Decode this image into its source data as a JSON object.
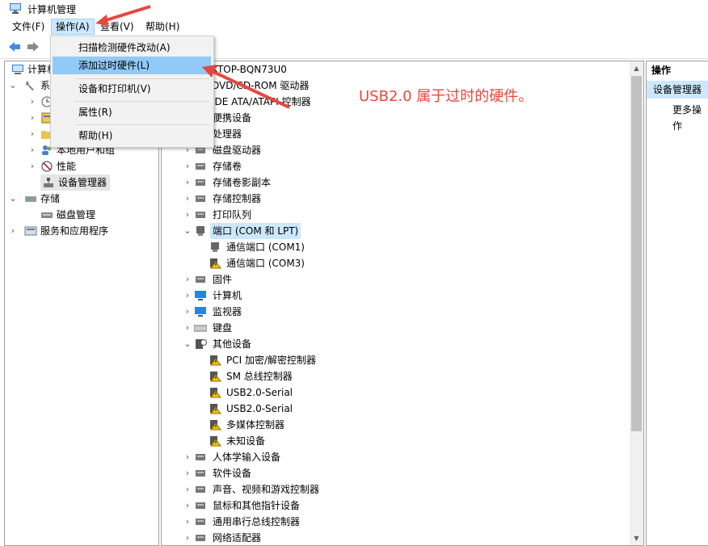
{
  "window": {
    "title": "计算机管理"
  },
  "menubar": [
    "文件(F)",
    "操作(A)",
    "查看(V)",
    "帮助(H)"
  ],
  "dropdown": {
    "items": [
      "扫描检测硬件改动(A)",
      "添加过时硬件(L)",
      "设备和打印机(V)",
      "属性(R)",
      "帮助(H)"
    ],
    "highlighted": "添加过时硬件(L)"
  },
  "left_tree": {
    "root_label": "计算机",
    "items": {
      "system": "系",
      "local_users": "本地用户和组",
      "performance": "性能",
      "device_manager": "设备管理器",
      "storage": "存储",
      "disk_management": "磁盘管理",
      "services": "服务和应用程序"
    }
  },
  "device_tree": {
    "computer_name": "KTOP-BQN73U0",
    "dvd": "DVD/CD-ROM 驱动器",
    "ide": "IDE ATA/ATAPI 控制器",
    "categories": [
      {
        "label": "便携设备",
        "icon": "portable-icon"
      },
      {
        "label": "处理器",
        "icon": "cpu-icon"
      },
      {
        "label": "磁盘驱动器",
        "icon": "disk-icon"
      },
      {
        "label": "存储卷",
        "icon": "volume-icon"
      },
      {
        "label": "存储卷影副本",
        "icon": "volume-icon"
      },
      {
        "label": "存储控制器",
        "icon": "storage-controller-icon"
      },
      {
        "label": "打印队列",
        "icon": "printer-icon"
      }
    ],
    "ports": {
      "label": "端口 (COM 和 LPT)",
      "children": [
        "通信端口 (COM1)",
        "通信端口 (COM3)"
      ]
    },
    "categories2": [
      {
        "label": "固件",
        "icon": "firmware-icon"
      },
      {
        "label": "计算机",
        "icon": "computer-icon"
      },
      {
        "label": "监视器",
        "icon": "monitor-icon"
      },
      {
        "label": "键盘",
        "icon": "keyboard-icon"
      }
    ],
    "other": {
      "label": "其他设备",
      "children": [
        "PCI 加密/解密控制器",
        "SM 总线控制器",
        "USB2.0-Serial",
        "USB2.0-Serial",
        "多媒体控制器",
        "未知设备"
      ]
    },
    "categories3": [
      {
        "label": "人体学输入设备",
        "icon": "hid-icon"
      },
      {
        "label": "软件设备",
        "icon": "software-device-icon"
      },
      {
        "label": "声音、视频和游戏控制器",
        "icon": "speaker-icon"
      },
      {
        "label": "鼠标和其他指针设备",
        "icon": "mouse-icon"
      },
      {
        "label": "通用串行总线控制器",
        "icon": "usb-icon"
      },
      {
        "label": "网络适配器",
        "icon": "network-icon"
      }
    ]
  },
  "actions": {
    "header": "操作",
    "selected": "设备管理器",
    "more": "更多操作"
  },
  "annotation": "USB2.0 属于过时的硬件。",
  "colors": {
    "annotation": "#e8473d",
    "highlight": "#91c9f7",
    "selection": "#cce8ff"
  }
}
